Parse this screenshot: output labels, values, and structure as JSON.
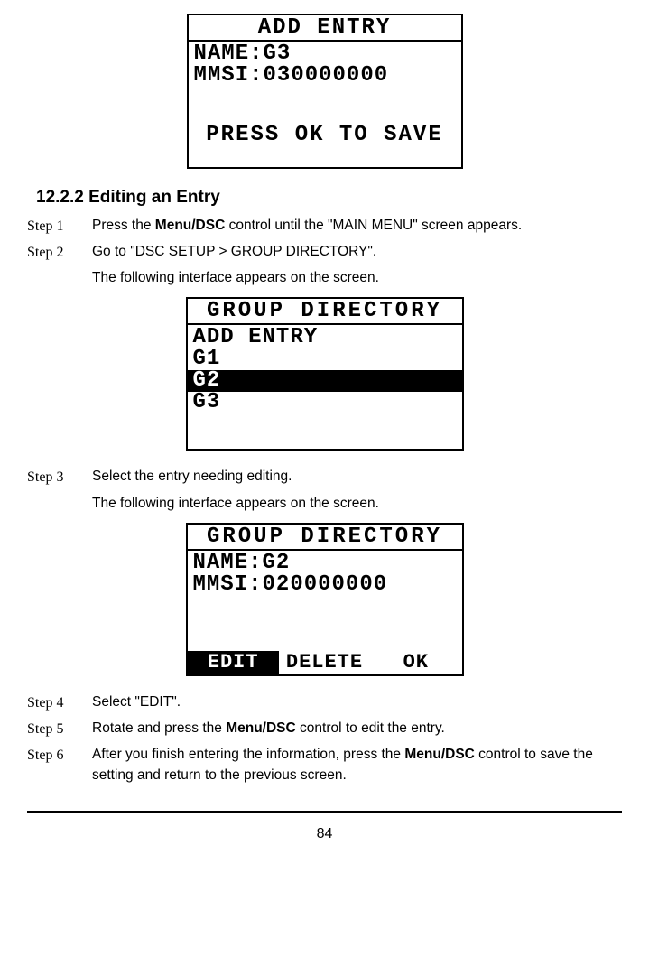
{
  "screen1": {
    "title": "ADD ENTRY",
    "name_label": "NAME:",
    "name_value": "G3",
    "mmsi_label": "MMSI:",
    "mmsi_value": "030000000",
    "footer": "PRESS OK TO SAVE"
  },
  "section": {
    "number": "12.2.2",
    "title": "Editing an Entry"
  },
  "steps": {
    "s1_label": "Step 1",
    "s1_pre": "Press the ",
    "s1_bold": "Menu/DSC",
    "s1_post": " control until the \"MAIN MENU\" screen appears.",
    "s2_label": "Step 2",
    "s2_text": "Go to \"DSC SETUP > GROUP DIRECTORY\".",
    "s2_follow": "The following interface appears on the screen.",
    "s3_label": "Step 3",
    "s3_text": "Select the entry needing editing.",
    "s3_follow": "The following interface appears on the screen.",
    "s4_label": "Step 4",
    "s4_text": "Select \"EDIT\".",
    "s5_label": "Step 5",
    "s5_pre": "Rotate and press the ",
    "s5_bold": "Menu/DSC",
    "s5_post": " control to edit the entry.",
    "s6_label": "Step 6",
    "s6_pre": "After you finish entering the information, press the ",
    "s6_bold": "Menu/DSC",
    "s6_post": " control to save the setting and return to the previous screen."
  },
  "screen2": {
    "title": "GROUP DIRECTORY",
    "r1": "ADD ENTRY",
    "r2": "G1",
    "r3": "G2",
    "r4": "G3"
  },
  "screen3": {
    "title": "GROUP DIRECTORY",
    "name_label": "NAME:",
    "name_value": "G2",
    "mmsi_label": "MMSI:",
    "mmsi_value": "020000000",
    "tab_edit": "EDIT",
    "tab_delete": "DELETE",
    "tab_ok": "OK"
  },
  "page_number": "84"
}
